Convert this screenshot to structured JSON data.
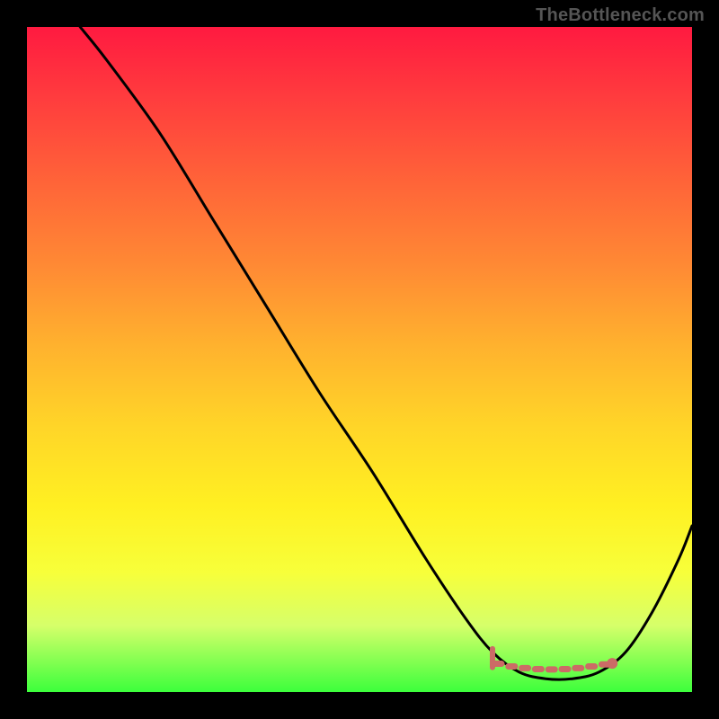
{
  "watermark": "TheBottleneck.com",
  "chart_data": {
    "type": "line",
    "title": "",
    "xlabel": "",
    "ylabel": "",
    "xlim": [
      0,
      100
    ],
    "ylim": [
      0,
      100
    ],
    "grid": false,
    "series": [
      {
        "name": "curve",
        "color": "#000000",
        "x": [
          8,
          12,
          20,
          28,
          36,
          44,
          52,
          60,
          66,
          70,
          74,
          78,
          82,
          86,
          90,
          94,
          98,
          100
        ],
        "values": [
          100,
          95,
          84,
          71,
          58,
          45,
          33,
          20,
          11,
          6,
          3,
          2,
          2,
          3,
          6,
          12,
          20,
          25
        ]
      },
      {
        "name": "bottom-dots",
        "color": "#cc6b66",
        "x": [
          70,
          72,
          74,
          76,
          78,
          80,
          82,
          84,
          86,
          88
        ],
        "values": [
          4.5,
          4.0,
          3.7,
          3.5,
          3.4,
          3.4,
          3.5,
          3.7,
          4.0,
          4.3
        ]
      }
    ],
    "annotations": []
  }
}
